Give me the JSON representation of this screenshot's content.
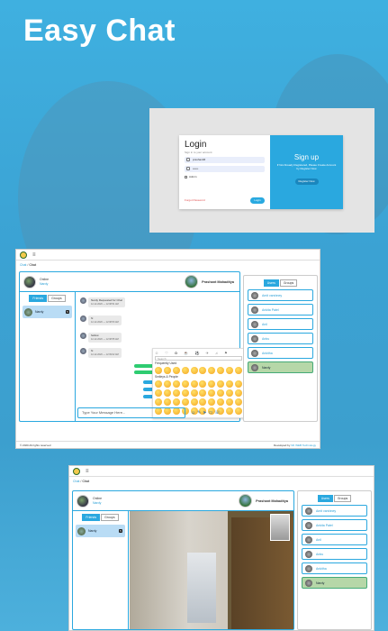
{
  "page": {
    "title": "Easy Chat"
  },
  "login": {
    "heading": "Login",
    "subtitle": "Sign in to your account",
    "username_value": "prashantM",
    "password_value": "••••••",
    "admin_label": "Admin",
    "forgot_label": "Forgot Password",
    "login_button": "Login",
    "signup_heading": "Sign up",
    "signup_text": "If Not Already Registered, Please Create Account by Register Now",
    "register_button": "Register Now"
  },
  "chat": {
    "breadcrumb_home": "Chat",
    "breadcrumb_current": "Chat",
    "self_status": "Online",
    "self_name": "Nardy",
    "partner_name": "Prashant Mahaditya",
    "tabs": [
      "Friends",
      "Groups"
    ],
    "friend_name": "Nardy",
    "friend_count": "5",
    "messages": [
      {
        "text": "Nardy Requested for Chat",
        "time": "12-12-2020 — 12:38:51 AM"
      },
      {
        "text": "hi",
        "time": "12-12-2020 — 12:38:53 AM"
      },
      {
        "text": "hellow",
        "time": "12-12-2020 — 12:38:55 AM"
      },
      {
        "text": "hi",
        "time": "12-12-2020 — 12:39:02 AM"
      }
    ],
    "composer_placeholder": "Type Your Message Here...",
    "emoji_search": "Search",
    "emoji_frequent": "Frequently Used",
    "emoji_smileys": "Smileys & People",
    "right_tabs": [
      "Users",
      "Groups"
    ],
    "users": [
      "Amit varshney",
      "Ankita Patel",
      "Anil",
      "Anbu",
      "Ankitha",
      "Nardy"
    ],
    "footer_left": "© 2020 All rights reserved",
    "footer_right_prefix": "Developed by",
    "footer_right_link": "NK WEB Technology"
  }
}
